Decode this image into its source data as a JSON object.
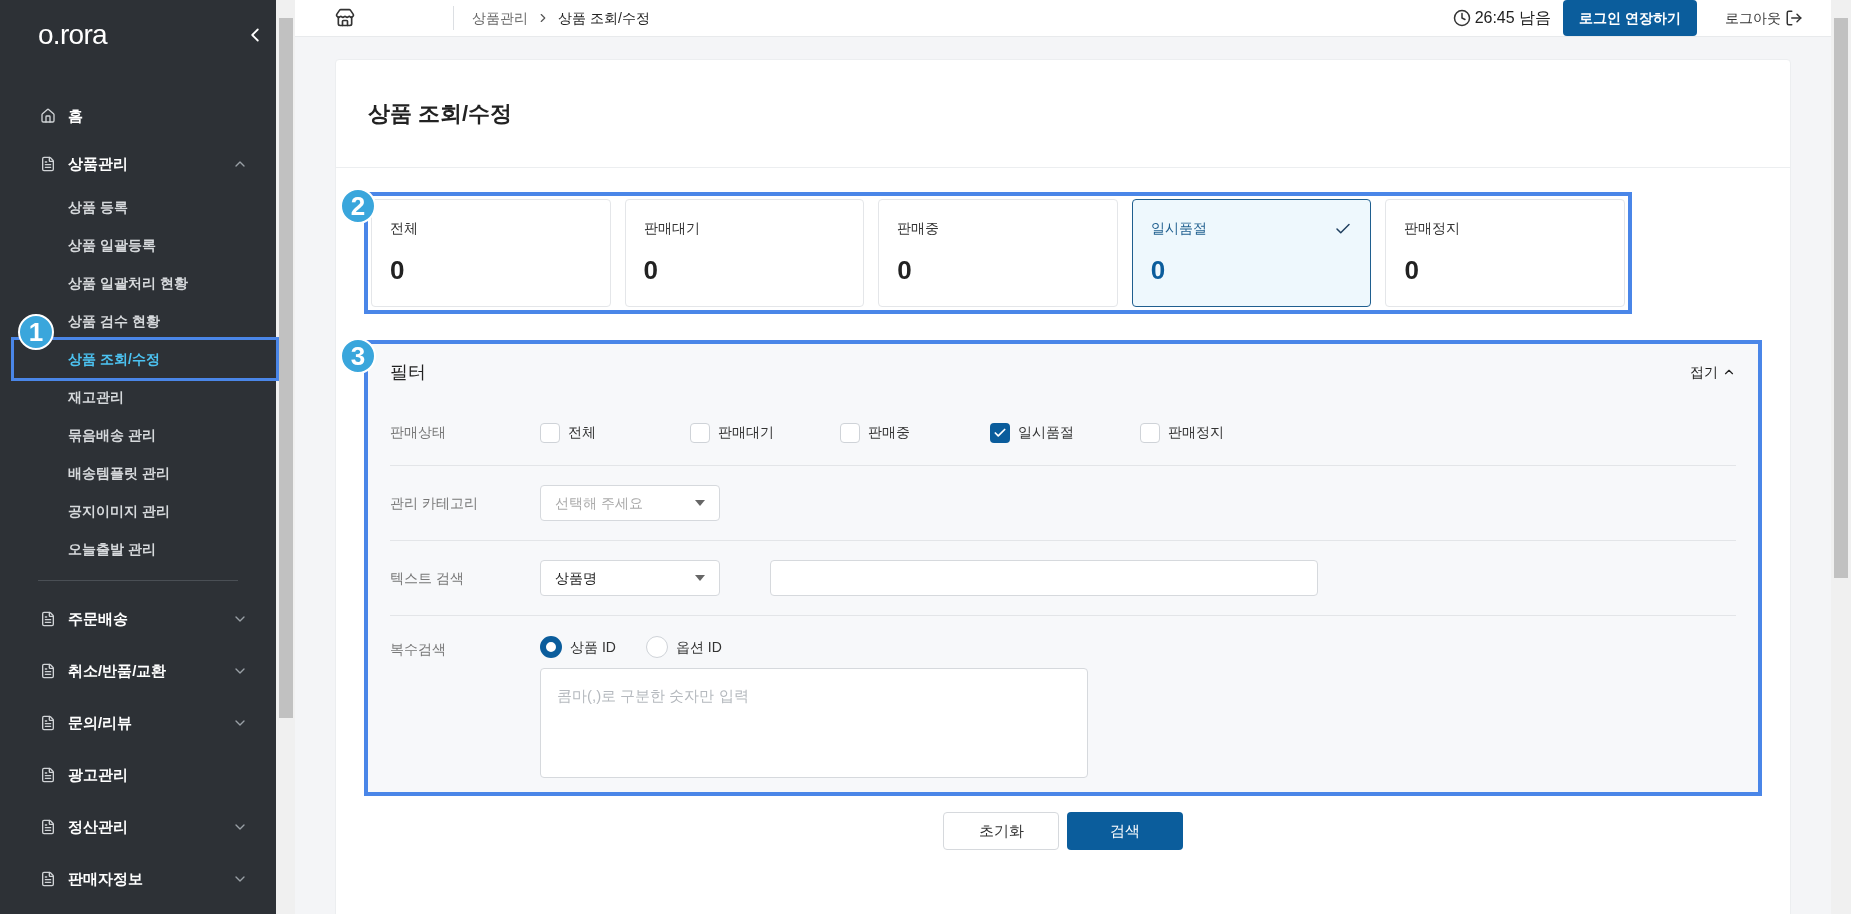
{
  "sidebar": {
    "logo": "o.rora",
    "items": [
      {
        "kind": "home",
        "label": "홈"
      },
      {
        "kind": "group",
        "label": "상품관리",
        "expanded": true,
        "children": [
          {
            "label": "상품 등록",
            "selected": false
          },
          {
            "label": "상품 일괄등록",
            "selected": false
          },
          {
            "label": "상품 일괄처리 현황",
            "selected": false
          },
          {
            "label": "상품 검수 현황",
            "selected": false
          },
          {
            "label": "상품 조회/수정",
            "selected": true
          },
          {
            "label": "재고관리",
            "selected": false
          },
          {
            "label": "묶음배송 관리",
            "selected": false
          },
          {
            "label": "배송템플릿 관리",
            "selected": false
          },
          {
            "label": "공지이미지 관리",
            "selected": false
          },
          {
            "label": "오늘출발 관리",
            "selected": false
          }
        ]
      },
      {
        "kind": "group",
        "label": "주문배송",
        "expanded": false
      },
      {
        "kind": "group",
        "label": "취소/반품/교환",
        "expanded": false
      },
      {
        "kind": "group",
        "label": "문의/리뷰",
        "expanded": false
      },
      {
        "kind": "link",
        "label": "광고관리"
      },
      {
        "kind": "group",
        "label": "정산관리",
        "expanded": false
      },
      {
        "kind": "group",
        "label": "판매자정보",
        "expanded": false
      }
    ]
  },
  "top_bar": {
    "breadcrumb": [
      "상품관리",
      "상품 조회/수정"
    ],
    "timer": "26:45 남음",
    "extend_button": "로그인 연장하기",
    "logout": "로그아웃"
  },
  "page_title": "상품 조회/수정",
  "status_cards": [
    {
      "label": "전체",
      "value": "0",
      "selected": false
    },
    {
      "label": "판매대기",
      "value": "0",
      "selected": false
    },
    {
      "label": "판매중",
      "value": "0",
      "selected": false
    },
    {
      "label": "일시품절",
      "value": "0",
      "selected": true
    },
    {
      "label": "판매정지",
      "value": "0",
      "selected": false
    }
  ],
  "filter": {
    "title": "필터",
    "toggle": "접기",
    "sale_status": {
      "label": "판매상태",
      "options": [
        {
          "label": "전체",
          "checked": false
        },
        {
          "label": "판매대기",
          "checked": false
        },
        {
          "label": "판매중",
          "checked": false
        },
        {
          "label": "일시품절",
          "checked": true
        },
        {
          "label": "판매정지",
          "checked": false
        }
      ]
    },
    "category": {
      "label": "관리 카테고리",
      "placeholder": "선택해 주세요"
    },
    "text_search": {
      "label": "텍스트 검색",
      "value": "상품명"
    },
    "multi_search": {
      "label": "복수검색",
      "options": [
        {
          "label": "상품 ID",
          "selected": true
        },
        {
          "label": "옵션 ID",
          "selected": false
        }
      ],
      "placeholder": "콤마(,)로 구분한 숫자만 입력"
    }
  },
  "buttons": [
    "초기화",
    "검색"
  ],
  "annotations": [
    {
      "number": "1"
    },
    {
      "number": "2"
    },
    {
      "number": "3"
    }
  ]
}
